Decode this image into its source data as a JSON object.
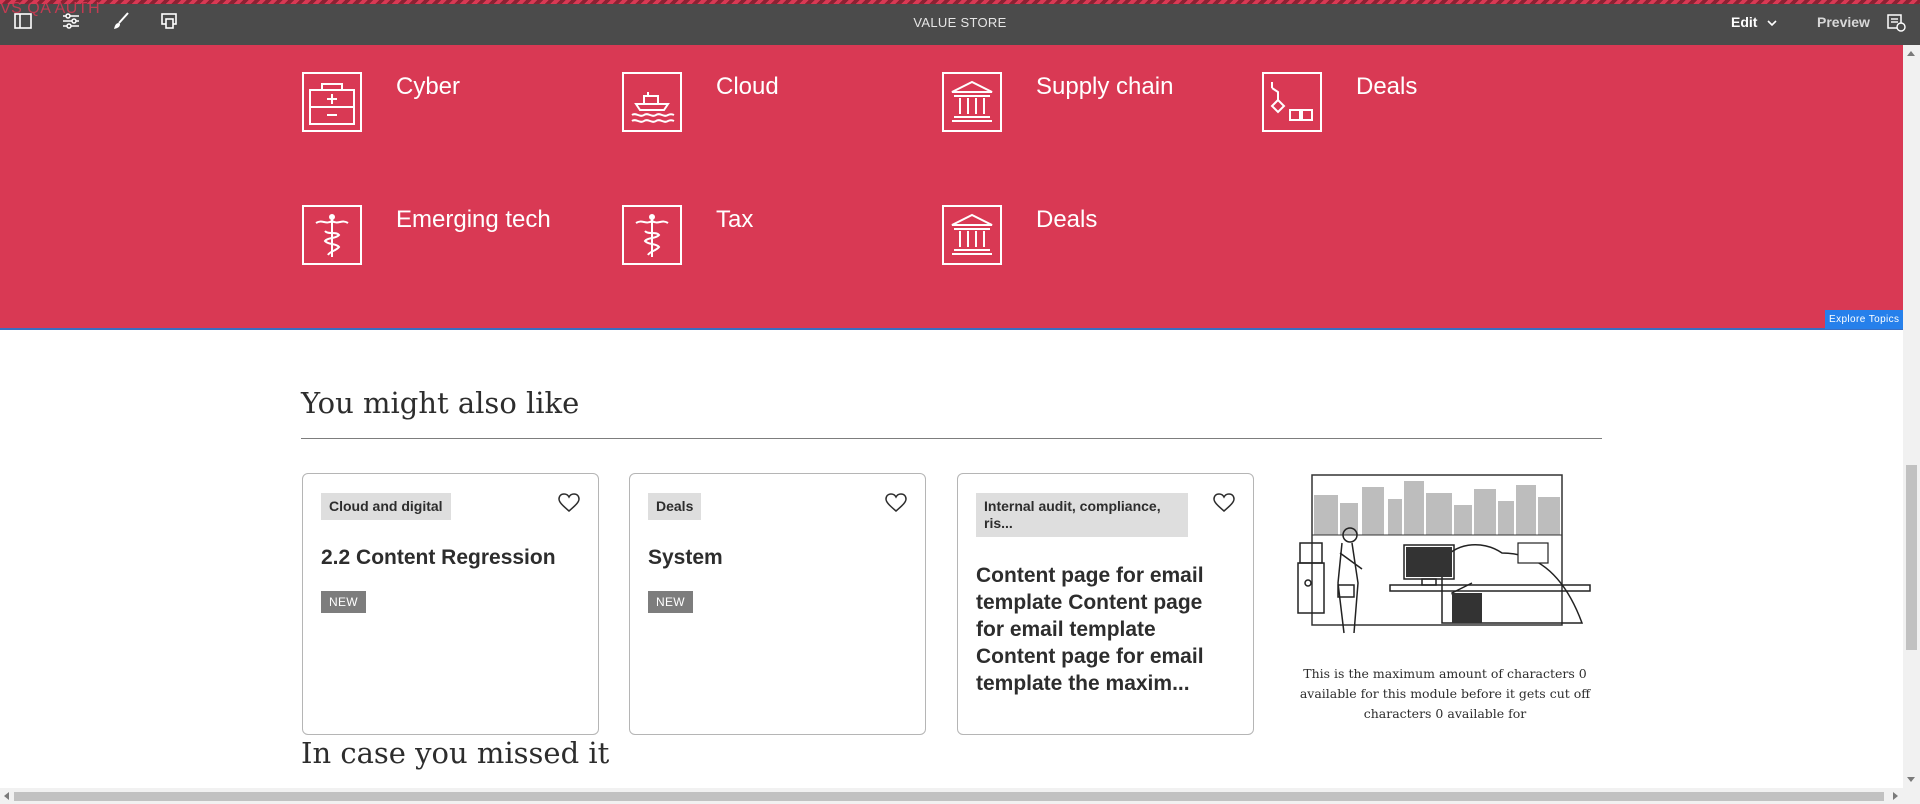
{
  "toolbar": {
    "env_label": "VS QA AUTH",
    "title": "VALUE STORE",
    "edit_label": "Edit",
    "preview_label": "Preview",
    "icons": [
      "side-panel-icon",
      "page-properties-icon",
      "brush-icon",
      "emulator-icon",
      "annotations-icon"
    ]
  },
  "topics": {
    "accent_color": "#d93954",
    "items": [
      {
        "label": "Cyber",
        "icon": "first-aid-kit-icon"
      },
      {
        "label": "Cloud",
        "icon": "ship-icon"
      },
      {
        "label": "Supply chain",
        "icon": "bank-icon"
      },
      {
        "label": "Deals",
        "icon": "crane-icon"
      },
      {
        "label": "Emerging tech",
        "icon": "caduceus-icon"
      },
      {
        "label": "Tax",
        "icon": "caduceus-icon"
      },
      {
        "label": "Deals",
        "icon": "bank-icon"
      }
    ],
    "component_tag": "Explore Topics"
  },
  "related": {
    "heading": "You might also like",
    "cards": [
      {
        "tag": "Cloud and digital",
        "title": "2.2 Content Regression",
        "badge": "NEW"
      },
      {
        "tag": "Deals",
        "title": "System",
        "badge": "NEW"
      },
      {
        "tag": "Internal audit, compliance, ris...",
        "title": "Content page for email template Content page for email template Content page for email template the maxim..."
      }
    ],
    "promo": {
      "caption": "This is the maximum amount of characters 0 available for this module before it gets cut off characters 0 available for"
    }
  },
  "missed": {
    "heading": "In case you missed it"
  }
}
